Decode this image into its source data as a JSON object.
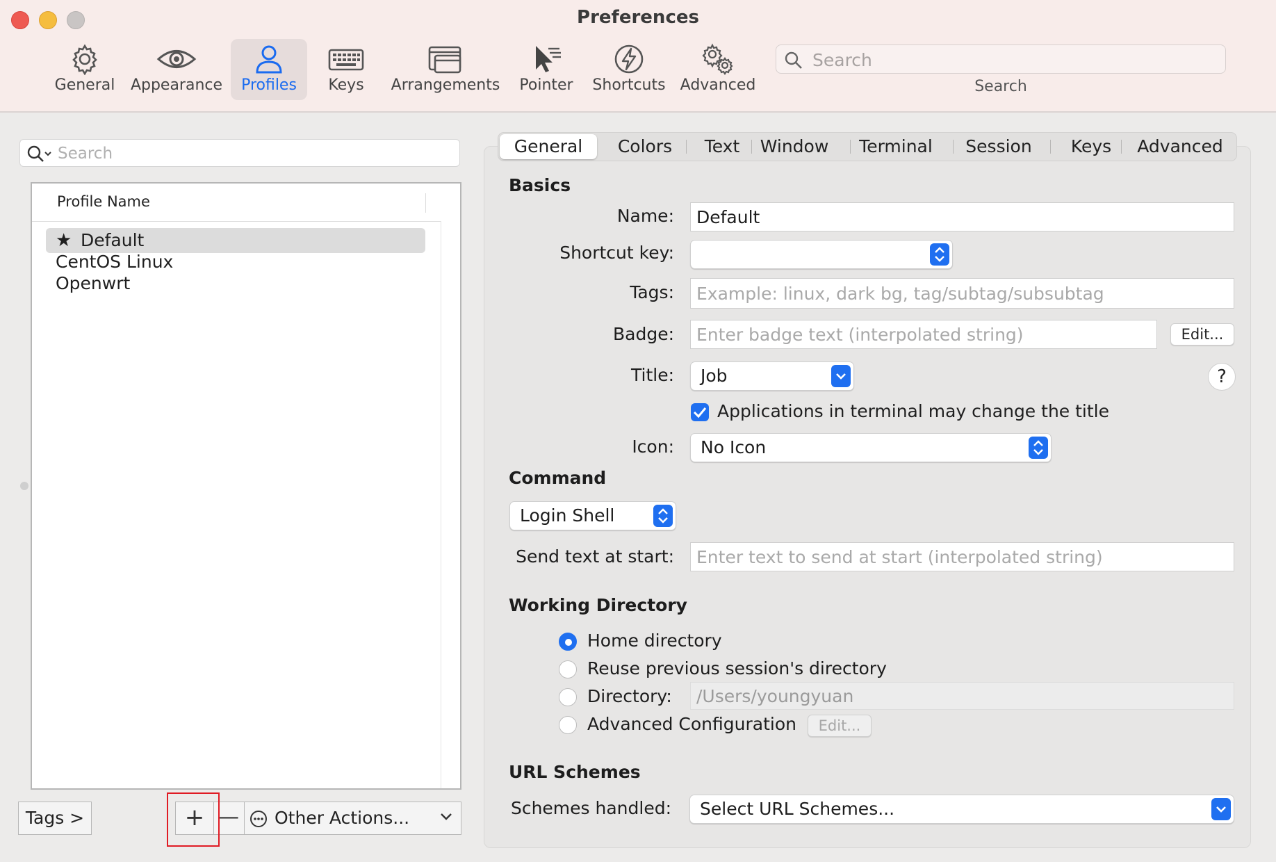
{
  "window": {
    "title": "Preferences"
  },
  "toolbar": {
    "items": [
      {
        "label": "General",
        "icon": "gear-icon"
      },
      {
        "label": "Appearance",
        "icon": "eye-icon"
      },
      {
        "label": "Profiles",
        "icon": "person-icon",
        "selected": true
      },
      {
        "label": "Keys",
        "icon": "keyboard-icon"
      },
      {
        "label": "Arrangements",
        "icon": "windows-icon"
      },
      {
        "label": "Pointer",
        "icon": "pointer-icon"
      },
      {
        "label": "Shortcuts",
        "icon": "lightning-icon"
      },
      {
        "label": "Advanced",
        "icon": "gears-icon"
      }
    ],
    "search": {
      "placeholder": "Search",
      "label": "Search"
    }
  },
  "profiles": {
    "search_placeholder": "Search",
    "column_header": "Profile Name",
    "items": [
      {
        "name": "Default",
        "is_default": true,
        "selected": true
      },
      {
        "name": "CentOS Linux"
      },
      {
        "name": "Openwrt"
      }
    ],
    "tags_button": "Tags >",
    "add_button": "+",
    "remove_button": "—",
    "other_actions": "Other Actions..."
  },
  "tabs": [
    "General",
    "Colors",
    "Text",
    "Window",
    "Terminal",
    "Session",
    "Keys",
    "Advanced"
  ],
  "selected_tab": "General",
  "basics": {
    "title": "Basics",
    "name_label": "Name:",
    "name_value": "Default",
    "shortcut_label": "Shortcut key:",
    "shortcut_value": "",
    "tags_label": "Tags:",
    "tags_placeholder": "Example: linux, dark bg, tag/subtag/subsubtag",
    "badge_label": "Badge:",
    "badge_placeholder": "Enter badge text (interpolated string)",
    "badge_edit": "Edit...",
    "title_label": "Title:",
    "title_value": "Job",
    "help": "?",
    "apps_change_title": "Applications in terminal may change the title",
    "apps_change_title_checked": true,
    "icon_label": "Icon:",
    "icon_value": "No Icon"
  },
  "command": {
    "title": "Command",
    "value": "Login Shell",
    "send_text_label": "Send text at start:",
    "send_text_placeholder": "Enter text to send at start (interpolated string)"
  },
  "working_directory": {
    "title": "Working Directory",
    "home": "Home directory",
    "reuse": "Reuse previous session's directory",
    "directory": "Directory:",
    "directory_value": "/Users/youngyuan",
    "advanced": "Advanced Configuration",
    "advanced_edit": "Edit...",
    "selected": "home"
  },
  "url_schemes": {
    "title": "URL Schemes",
    "label": "Schemes handled:",
    "value": "Select URL Schemes..."
  },
  "colors": {
    "accent": "#1f6ff0",
    "highlight_box": "#e01b24",
    "toolbar_bg": "#f8ecea"
  }
}
